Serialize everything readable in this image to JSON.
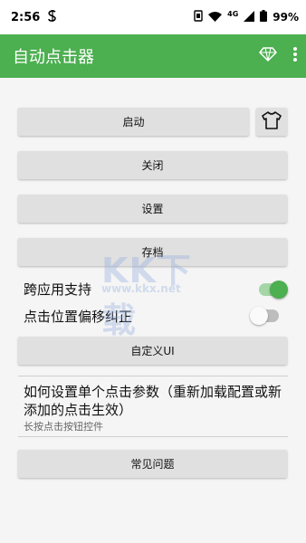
{
  "status_bar": {
    "time": "2:56",
    "network": "4G",
    "battery": "99%"
  },
  "app_bar": {
    "title": "自动点击器"
  },
  "buttons": {
    "start": "启动",
    "close": "关闭",
    "settings": "设置",
    "archive": "存档",
    "custom_ui": "自定义UI",
    "faq": "常见问题"
  },
  "options": [
    {
      "label": "跨应用支持",
      "enabled": true
    },
    {
      "label": "点击位置偏移纠正",
      "enabled": false
    }
  ],
  "help": {
    "title": "如何设置单个点击参数（重新加载配置或新添加的点击生效）",
    "subtitle": "长按点击按钮控件"
  },
  "watermark": {
    "logo_text": "KK下载",
    "url": "www.kkx.net"
  },
  "colors": {
    "primary": "#4CAF50",
    "button": "#e0e0e0",
    "background": "#f5f5f5"
  }
}
